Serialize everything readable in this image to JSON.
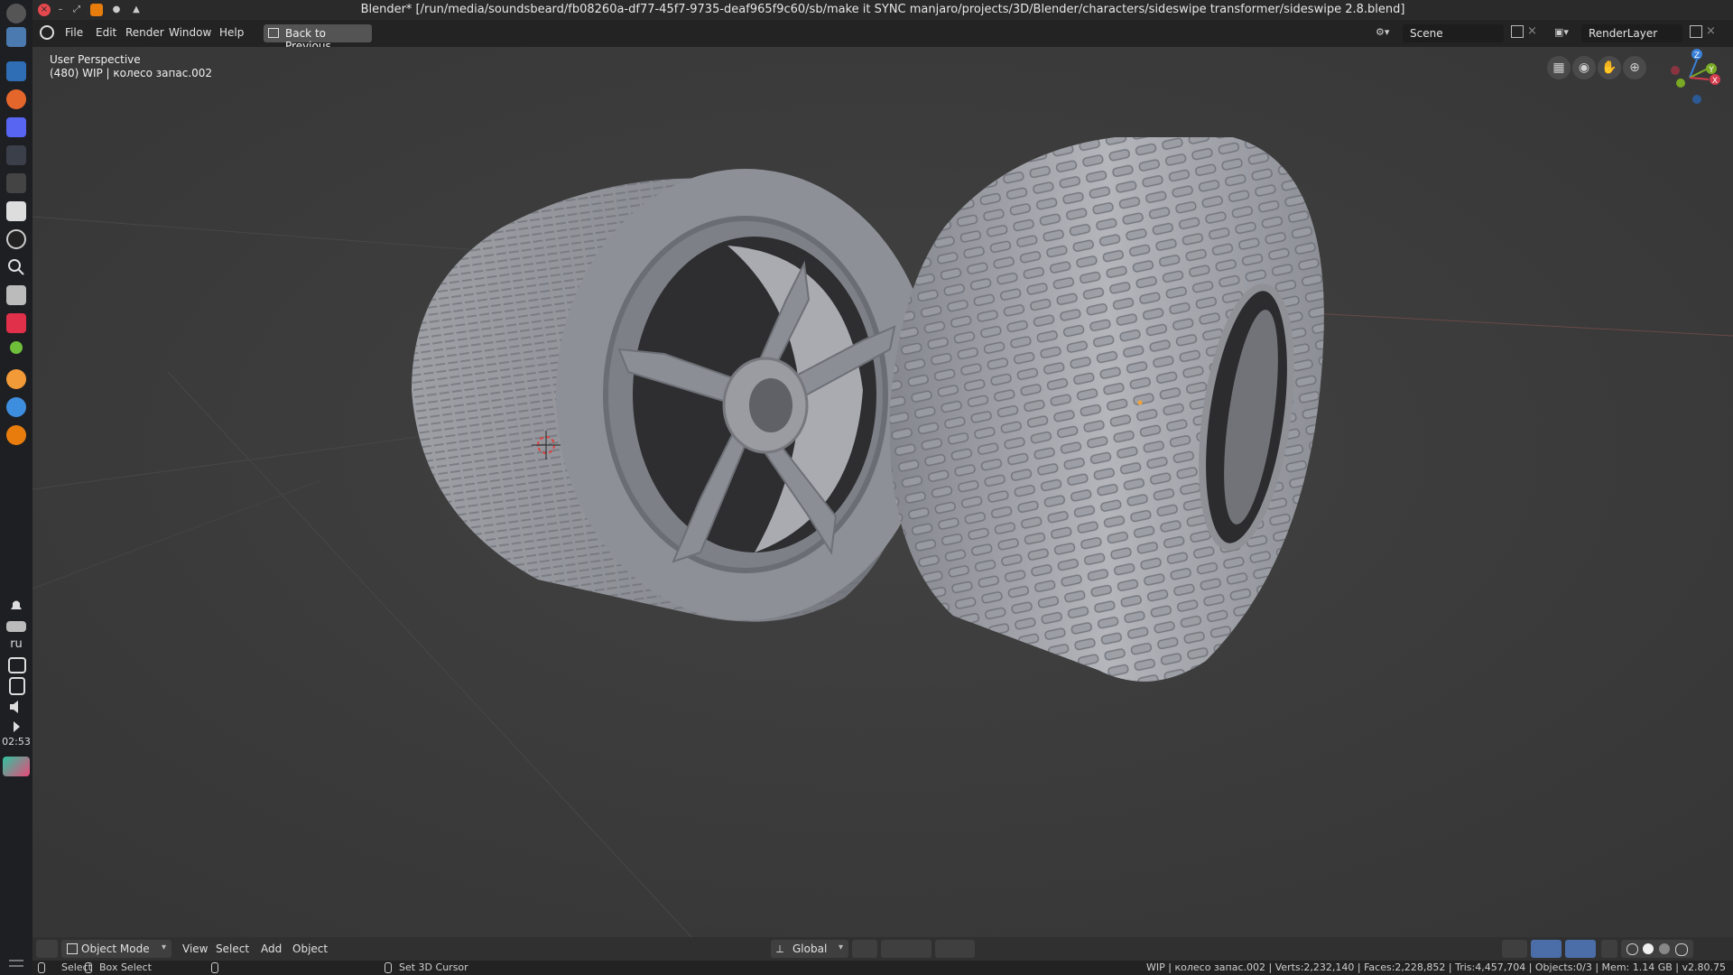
{
  "window": {
    "title": "Blender* [/run/media/soundsbeard/fb08260a-df77-45f7-9735-deaf965f9c60/sb/make it SYNC manjaro/projects/3D/Blender/characters/sideswipe transformer/sideswipe 2.8.blend]"
  },
  "menu": {
    "file": "File",
    "edit": "Edit",
    "render": "Render",
    "window": "Window",
    "help": "Help",
    "back_to_previous": "Back to Previous"
  },
  "scene": {
    "name": "Scene"
  },
  "view_layer": {
    "name": "RenderLayer"
  },
  "viewport": {
    "view_name": "User Perspective",
    "object_info": "(480) WIP | колесо запас.002",
    "gizmo": {
      "x": "X",
      "y": "Y",
      "z": "Z"
    }
  },
  "header": {
    "mode": "Object Mode",
    "view": "View",
    "select": "Select",
    "add": "Add",
    "object": "Object",
    "transform_orientation": "Global"
  },
  "status": {
    "select": "Select",
    "box_select": "Box Select",
    "set_cursor": "Set 3D Cursor",
    "stats": "WIP | колесо запас.002 | Verts:2,232,140 | Faces:2,228,852 | Tris:4,457,704 | Objects:0/3 | Mem: 1.14 GB | v2.80.75"
  },
  "system": {
    "language": "ru",
    "clock": "02:53"
  },
  "colors": {
    "viewport_bg": "#3d3d3d",
    "x_axis": "#d43d4d",
    "y_axis": "#7aaa24",
    "z_axis": "#3a80d8"
  }
}
